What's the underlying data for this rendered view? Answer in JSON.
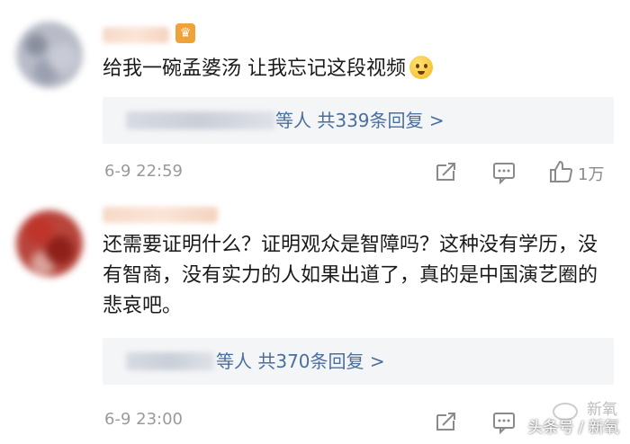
{
  "comments": [
    {
      "text": "给我一碗孟婆汤 让我忘记这段视频",
      "reply_summary": "等人  共339条回复 >",
      "timestamp": "6-9 22:59",
      "like_count": "1万"
    },
    {
      "text": "还需要证明什么？证明观众是智障吗？这种没有学历，没有智商，没有实力的人如果出道了，真的是中国演艺圈的悲哀吧。",
      "reply_summary": "等人  共370条回复 >",
      "timestamp": "6-9 23:00",
      "like_count": ""
    }
  ],
  "watermark": {
    "text": "头条号 / 新氧",
    "name": "新氧"
  },
  "colors": {
    "reply_link": "#4a6e9e",
    "meta_gray": "#9a9a9a",
    "reply_bg": "#f4f5f7"
  }
}
